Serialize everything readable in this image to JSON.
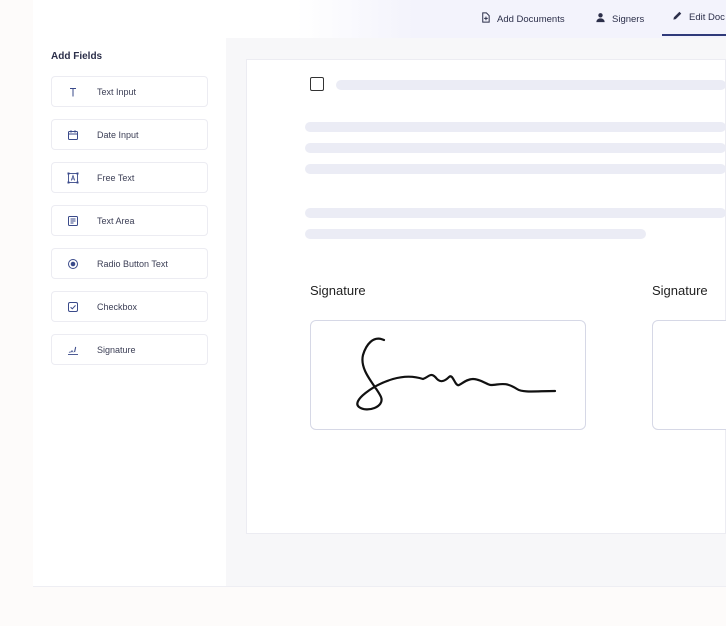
{
  "nav": {
    "tabs": [
      {
        "label": "Add Documents",
        "icon": "document-add-icon"
      },
      {
        "label": "Signers",
        "icon": "user-icon"
      },
      {
        "label": "Edit Doc",
        "icon": "pencil-icon",
        "active": true
      }
    ]
  },
  "sidebar": {
    "title": "Add Fields",
    "items": [
      {
        "label": "Text Input",
        "icon": "text-icon"
      },
      {
        "label": "Date Input",
        "icon": "calendar-icon"
      },
      {
        "label": "Free Text",
        "icon": "free-text-icon"
      },
      {
        "label": "Text Area",
        "icon": "text-area-icon"
      },
      {
        "label": "Radio Button Text",
        "icon": "radio-icon"
      },
      {
        "label": "Checkbox",
        "icon": "checkbox-icon"
      },
      {
        "label": "Signature",
        "icon": "signature-icon"
      }
    ]
  },
  "document": {
    "signature_labels": [
      "Signature",
      "Signature"
    ]
  },
  "colors": {
    "accent": "#2f3a7a",
    "placeholder_bar": "#ebecf5"
  }
}
